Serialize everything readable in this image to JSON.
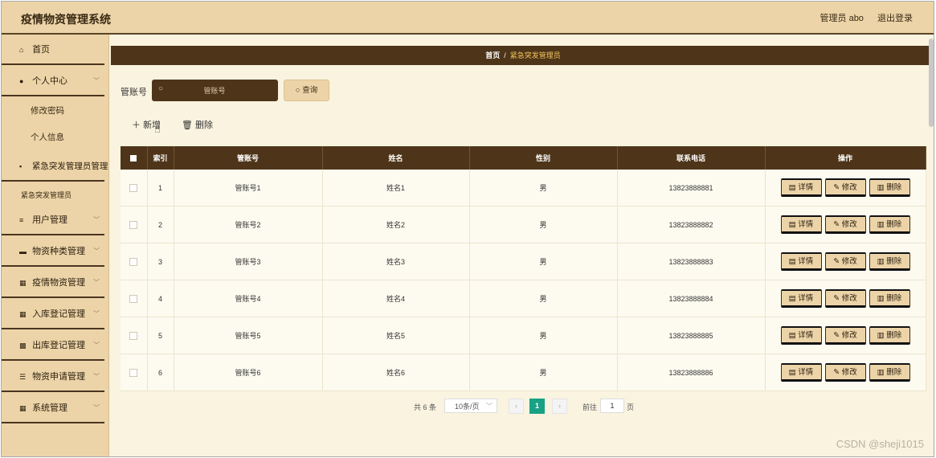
{
  "header": {
    "title": "疫情物资管理系统",
    "user": "管理员 abo",
    "logout": "退出登录"
  },
  "sidebar": {
    "items": [
      {
        "label": "首页",
        "icon": "home-icon"
      },
      {
        "label": "个人中心",
        "icon": "user-icon"
      },
      {
        "label": "修改密码"
      },
      {
        "label": "个人信息"
      },
      {
        "label": "紧急突发管理员管理",
        "icon": "card-icon"
      },
      {
        "label": "紧急突发管理员"
      },
      {
        "label": "用户管理",
        "icon": "list-icon"
      },
      {
        "label": "物资种类管理",
        "icon": "card-icon"
      },
      {
        "label": "疫情物资管理",
        "icon": "grid-icon"
      },
      {
        "label": "入库登记管理",
        "icon": "grid-icon"
      },
      {
        "label": "出库登记管理",
        "icon": "image-icon"
      },
      {
        "label": "物资申请管理",
        "icon": "filter-icon"
      },
      {
        "label": "系统管理",
        "icon": "grid-icon"
      }
    ]
  },
  "breadcrumb": {
    "home": "首页",
    "sep": "/",
    "current": "紧急突发管理员"
  },
  "search": {
    "label": "管账号",
    "placeholder": "管账号",
    "query_button": "查询"
  },
  "actions": {
    "add": "新增",
    "delete": "删除"
  },
  "table": {
    "headers": [
      "索引",
      "管账号",
      "姓名",
      "性别",
      "联系电话",
      "操作"
    ],
    "rows": [
      {
        "idx": "1",
        "acct": "管账号1",
        "name": "姓名1",
        "gender": "男",
        "phone": "13823888881"
      },
      {
        "idx": "2",
        "acct": "管账号2",
        "name": "姓名2",
        "gender": "男",
        "phone": "13823888882"
      },
      {
        "idx": "3",
        "acct": "管账号3",
        "name": "姓名3",
        "gender": "男",
        "phone": "13823888883"
      },
      {
        "idx": "4",
        "acct": "管账号4",
        "name": "姓名4",
        "gender": "男",
        "phone": "13823888884"
      },
      {
        "idx": "5",
        "acct": "管账号5",
        "name": "姓名5",
        "gender": "男",
        "phone": "13823888885"
      },
      {
        "idx": "6",
        "acct": "管账号6",
        "name": "姓名6",
        "gender": "男",
        "phone": "13823888886"
      }
    ],
    "ops": {
      "detail": "详情",
      "edit": "修改",
      "remove": "删除"
    }
  },
  "pagination": {
    "total": "共 6 条",
    "page_size": "10条/页",
    "prev": "‹",
    "current": "1",
    "next": "›",
    "goto_label": "前往",
    "goto_value": "1",
    "page_suffix": "页"
  },
  "watermark": "CSDN @sheji1015",
  "colors": {
    "accent": "#4e3519",
    "panel": "#ecd4a8",
    "page_current": "#19a185",
    "breadcrumb_current": "#f1c55c"
  }
}
